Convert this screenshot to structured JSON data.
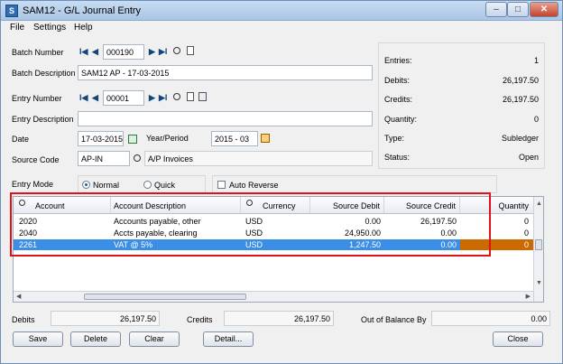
{
  "window": {
    "title": "SAM12 - G/L Journal Entry",
    "app_icon": "S",
    "buttons": {
      "min": "–",
      "max": "□",
      "close": "✕"
    }
  },
  "menu": [
    "File",
    "Settings",
    "Help"
  ],
  "batch": {
    "number_label": "Batch Number",
    "number": "000190",
    "description_label": "Batch Description",
    "description": "SAM12 AP - 17-03-2015"
  },
  "entry": {
    "number_label": "Entry Number",
    "number": "00001",
    "description_label": "Entry Description",
    "description": "",
    "date_label": "Date",
    "date": "17-03-2015",
    "year_period_label": "Year/Period",
    "year_period": "2015 - 03",
    "source_code_label": "Source Code",
    "source_code": "AP-IN",
    "source_code_desc": "A/P Invoices",
    "mode_label": "Entry Mode",
    "mode_normal": "Normal",
    "mode_quick": "Quick",
    "auto_reverse": "Auto Reverse"
  },
  "summary": {
    "entries_label": "Entries:",
    "entries": "1",
    "debits_label": "Debits:",
    "debits": "26,197.50",
    "credits_label": "Credits:",
    "credits": "26,197.50",
    "quantity_label": "Quantity:",
    "quantity": "0",
    "type_label": "Type:",
    "type": "Subledger",
    "status_label": "Status:",
    "status": "Open"
  },
  "grid": {
    "headers": {
      "account": "Account",
      "description": "Account Description",
      "currency": "Currency",
      "debit": "Source Debit",
      "credit": "Source Credit",
      "quantity": "Quantity"
    },
    "rows": [
      {
        "account": "2020",
        "description": "Accounts payable, other",
        "currency": "USD",
        "debit": "0.00",
        "credit": "26,197.50",
        "quantity": "0"
      },
      {
        "account": "2040",
        "description": "Accts payable, clearing",
        "currency": "USD",
        "debit": "24,950.00",
        "credit": "0.00",
        "quantity": "0"
      },
      {
        "account": "2261",
        "description": "VAT @ 5%",
        "currency": "USD",
        "debit": "1,247.50",
        "credit": "0.00",
        "quantity": "0"
      }
    ]
  },
  "totals": {
    "debits_label": "Debits",
    "debits": "26,197.50",
    "credits_label": "Credits",
    "credits": "26,197.50",
    "out_of_balance_label": "Out of Balance By",
    "out_of_balance": "0.00"
  },
  "buttons": {
    "save": "Save",
    "delete": "Delete",
    "clear": "Clear",
    "detail": "Detail...",
    "close": "Close"
  },
  "colors": {
    "selection": "#3a8ee6",
    "highlight_cell": "#cc6a00",
    "annotation": "#e3101a"
  }
}
